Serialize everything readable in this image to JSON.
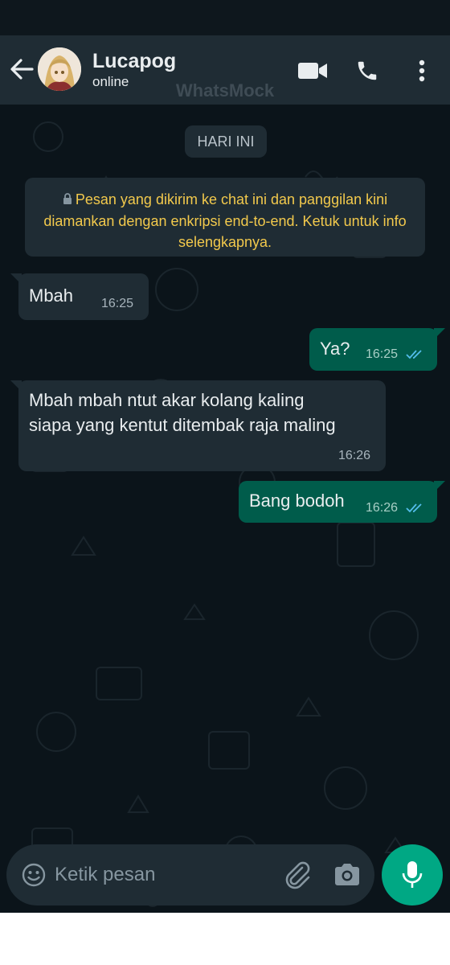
{
  "header": {
    "contact_name": "Lucapog",
    "status": "online",
    "watermark": "WhatsMock",
    "icons": [
      "back-arrow-icon",
      "avatar",
      "video-call-icon",
      "phone-icon",
      "more-vertical-icon"
    ]
  },
  "chat": {
    "day_label": "HARI INI",
    "encryption_notice": "Pesan yang dikirim ke chat ini dan panggilan kini diamankan dengan enkripsi end-to-end. Ketuk untuk info selengkapnya.",
    "messages": [
      {
        "direction": "incoming",
        "text": "Mbah",
        "time": "16:25"
      },
      {
        "direction": "outgoing",
        "text": "Ya?",
        "time": "16:25",
        "status": "read"
      },
      {
        "direction": "incoming",
        "lines": [
          "Mbah mbah ntut akar kolang kaling",
          "siapa yang kentut ditembak raja maling"
        ],
        "time": "16:26"
      },
      {
        "direction": "outgoing",
        "text": "Bang bodoh",
        "time": "16:26",
        "status": "read"
      }
    ]
  },
  "composer": {
    "placeholder": "Ketik pesan",
    "icons": [
      "emoji-icon",
      "attach-icon",
      "camera-icon",
      "mic-icon"
    ]
  },
  "colors": {
    "header_bg": "#1f2c34",
    "chat_bg": "#0b141a",
    "incoming_bubble": "#1f2c34",
    "outgoing_bubble": "#005c4b",
    "accent": "#00a884",
    "read_ticks": "#53bdeb",
    "notice_text": "#f2c94c"
  }
}
